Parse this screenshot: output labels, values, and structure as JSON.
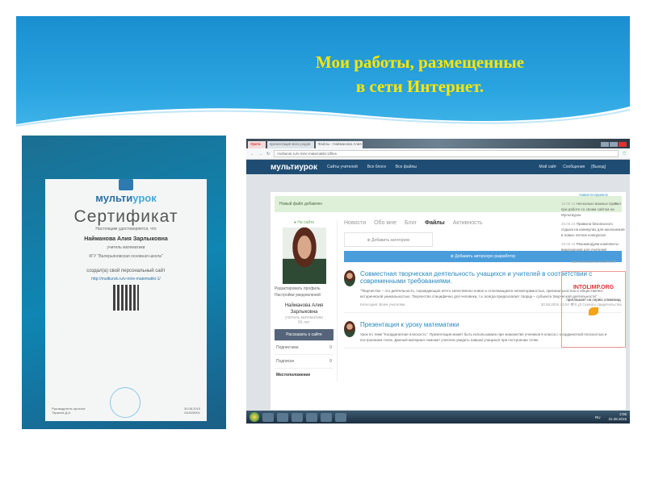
{
  "slide": {
    "title_line1": "Мои работы, размещенные",
    "title_line2": "в сети Интернет."
  },
  "certificate": {
    "brand_a": "мульти",
    "brand_b": "урок",
    "heading": "Сертификат",
    "intro": "Настоящим удостоверяется, что",
    "name": "Найманова Алия Зарлыковна",
    "position": "учитель математики",
    "school": "КГУ \"Валерьяновская основная школа\"",
    "created": "создал(а) свой персональный сайт",
    "url": "http://multiurok.ru/v-mire-matematiki-1/",
    "signer_role": "Руководитель проекта",
    "signer": "Тарасов Д.А.",
    "date": "30.08.2015",
    "number": "MU028901"
  },
  "browser": {
    "tabs": [
      "Opera",
      "презентация всех родов",
      "Файлы - Найманова Алия"
    ],
    "url": "multiurok.ru/v-mire-matematiki-1/files"
  },
  "site": {
    "brand": "мультиурок",
    "nav": [
      "Сайты учителей",
      "Все блоги",
      "Все файлы"
    ],
    "nav_right": [
      "Мой сайт",
      "Сообщения",
      "[Выход]"
    ],
    "alert": "Новый файл добавлен",
    "alert_close": "×",
    "sidebar": {
      "online": "● На сайте",
      "edit_profile": "Редактировать профиль",
      "notifications": "Настройки уведомлений",
      "name": "Найманова Алия Зарлыковна",
      "role": "учитель математики",
      "age": "56 лет",
      "share": "Рассказать о сайте",
      "rows": [
        {
          "label": "Подписчики",
          "count": "0"
        },
        {
          "label": "Подписки",
          "count": "0"
        }
      ],
      "location": "Местоположение"
    },
    "tabs": [
      "Новости",
      "Обо мне",
      "Блог",
      "Файлы",
      "Активность"
    ],
    "add_category": "⊕ Добавить категорию",
    "add_work": "⊕ Добавить авторскую разработку",
    "posts": [
      {
        "title": "Совместная творческая деятельность учащихся и учителей в соответствии с современными требованиями.",
        "text": "\"Творчество – это деятельность, порождающая нечто качественно новое и отличающаяся неповторимостью, оригинальностью и общественно-исторической уникальностью. Творчество специфично для человека, т.к. всегда предполагает творца – субъекта творческой деятельности\". ...",
        "category": "Категория: Всем учителям",
        "date": "30.08.2015 23:04",
        "views": "0",
        "downloads": "0",
        "download_link": "Скачать свидетельство"
      },
      {
        "title": "Презентация к уроку математики",
        "text": "Урок по теме \"Координатная плоскость\". Презентация может быть использована при знакомстве учеников 6 класса с координатной плоскостью и построением точек. Данный материал поможет учителю увидеть навыки учащихся при построении точек."
      }
    ],
    "news": {
      "heading": "Новости проекта",
      "items": [
        {
          "date": "18.08.15",
          "text": "Несколько важных правил при работе со своим сайтом на Мультиурок"
        },
        {
          "date": "25.06.15",
          "text": "Правила безопасного отдыха на каникулах для школьников в новых летних конкурсах!"
        },
        {
          "date": "29.05.15",
          "text": "Рекомендуем комплекты видеоуроков для учителей"
        }
      ],
      "howto": "Как пользоваться сайтом?"
    },
    "ad": {
      "brand_a": "INTO",
      "brand_b": "LIMP",
      "brand_c": ".ORG",
      "text": "приглашает на серию олимпиад"
    }
  },
  "taskbar": {
    "lang": "RU",
    "time": "2:05",
    "date": "31.08.2015"
  }
}
